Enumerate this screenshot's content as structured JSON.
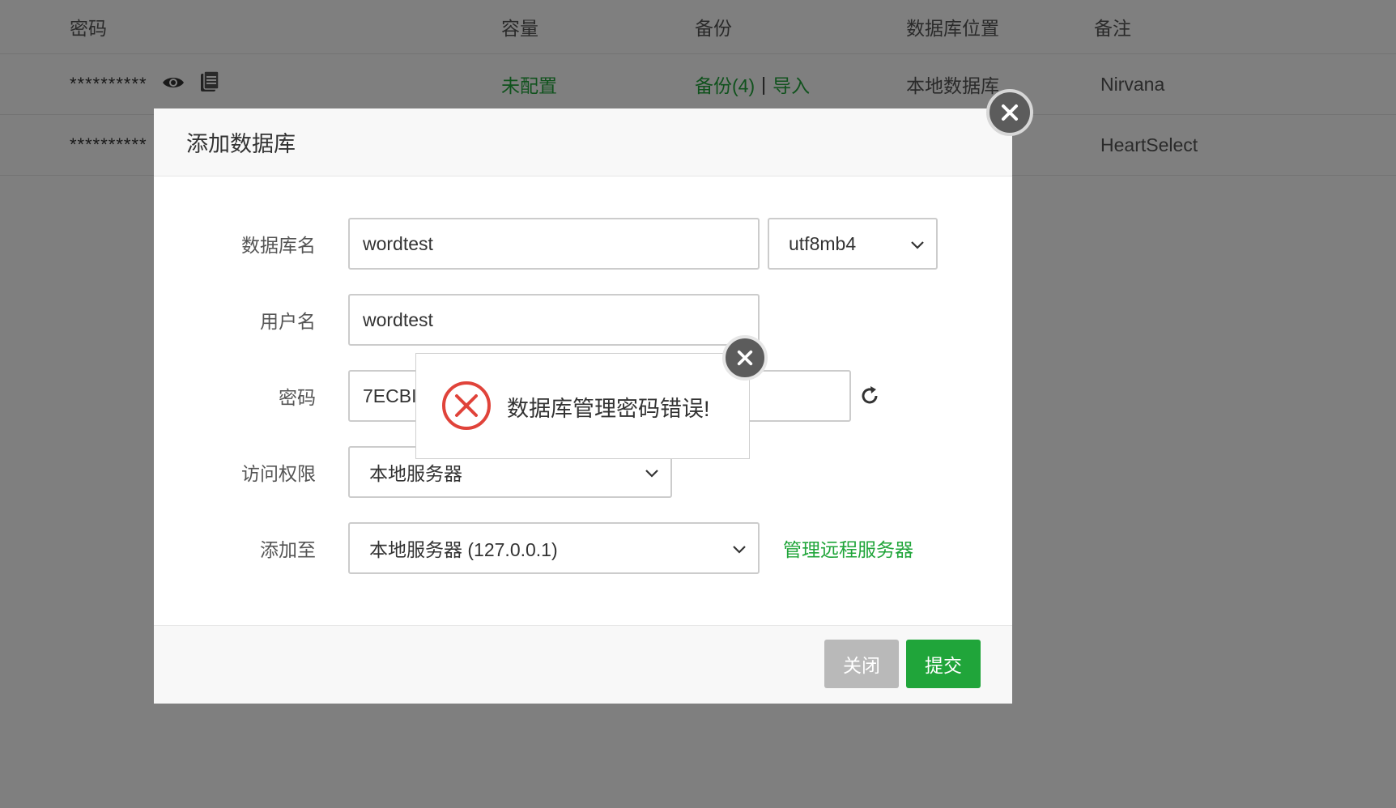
{
  "table": {
    "columns": [
      "密码",
      "容量",
      "备份",
      "数据库位置",
      "备注"
    ],
    "rows": [
      {
        "password": "**********",
        "capacity": "未配置",
        "backup": "备份(4)",
        "import": "导入",
        "location": "本地数据库",
        "note": "Nirvana"
      },
      {
        "password": "**********",
        "note": "HeartSelect"
      }
    ]
  },
  "dialog": {
    "title": "添加数据库",
    "fields": {
      "db_name": {
        "label": "数据库名",
        "value": "wordtest"
      },
      "charset": {
        "value": "utf8mb4"
      },
      "username": {
        "label": "用户名",
        "value": "wordtest"
      },
      "password": {
        "label": "密码",
        "value": "7ECBI"
      },
      "access": {
        "label": "访问权限",
        "value": "本地服务器"
      },
      "add_to": {
        "label": "添加至",
        "value": "本地服务器 (127.0.0.1)"
      }
    },
    "manage_remote_link": "管理远程服务器",
    "buttons": {
      "close": "关闭",
      "submit": "提交"
    }
  },
  "toast": {
    "message": "数据库管理密码错误!"
  },
  "colors": {
    "accent": "#20a53a",
    "error": "#e0433a",
    "overlay": "rgba(0,0,0,0.5)"
  }
}
